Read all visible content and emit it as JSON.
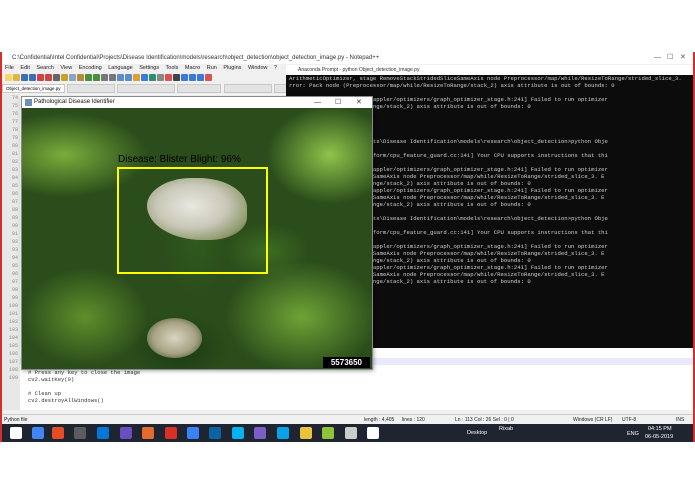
{
  "notepad": {
    "title": "C:\\Confidential\\Intel Confidential\\Projects\\Disease Identification\\models\\research\\object_detection\\object_detection_image.py - Notepad++",
    "menu": [
      "File",
      "Edit",
      "Search",
      "View",
      "Encoding",
      "Language",
      "Settings",
      "Tools",
      "Macro",
      "Run",
      "Plugins",
      "Window",
      "?"
    ],
    "tabs": [
      "Object_detection_image.py",
      "",
      "",
      "",
      "",
      ""
    ],
    "line_numbers": [
      "74",
      "75",
      "76",
      "77",
      "78",
      "79",
      "80",
      "81",
      "82",
      "83",
      "84",
      "85",
      "86",
      "87",
      "88",
      "89",
      "90",
      "91",
      "92",
      "93",
      "94",
      "95",
      "96",
      "97",
      "98",
      "99",
      "100",
      "101",
      "102",
      "103",
      "104",
      "105",
      "106",
      "107",
      "108",
      "109"
    ],
    "code": [
      "# Press any key to close the image",
      "cv2.waitKey(0)",
      "",
      "# Clean up",
      "cv2.destroyAllWindows()"
    ],
    "status": {
      "file_type": "Python file",
      "length": "length : 4,405",
      "lines": "lines : 120",
      "position": "Ln : 113   Col : 26   Sel : 0 | 0",
      "eol": "Windows (CR LF)",
      "encoding": "UTF-8",
      "mode": "INS"
    }
  },
  "console": {
    "title": "Anaconda Prompt - python  Object_detection_image.py",
    "lines": [
      "ArithmeticOptimizer, stage RemoveStackStridedSliceSameAxis node Preprocessor/map/while/ResizeToRange/strided_slice_3.",
      "rror: Pack node (Preprocessor/map/while/ResizeToRange/stack_2) axis attribute is out of bounds: 0",
      "",
      "7: W .\\tensorflow/core/grappler/optimizers/graph_optimizer_stage.h:241] Failed to run optimizer",
      "ssor/map/while/ResizeToRange/stack_2) axis attribute is out of bounds: 0",
      "",
      "",
      "",
      "",
      "Intel Confidential\\Projects\\Disease Identification\\models\\research\\object_detection>python Obje",
      "",
      "5: I tensorflow/core/platform/cpu_feature_guard.cc:141] Your CPU supports instructions that thi",
      "ot compiled to use: AVX2",
      "9: W .\\tensorflow/core/grappler/optimizers/graph_optimizer_stage.h:241] Failed to run optimizer",
      "e RemoveStackStridedSliceSameAxis node Preprocessor/map/while/ResizeToRange/strided_slice_3. E",
      "ssor/map/while/ResizeToRange/stack_2) axis attribute is out of bounds: 0",
      "0: W .\\tensorflow/core/grappler/optimizers/graph_optimizer_stage.h:241] Failed to run optimizer",
      "e RemoveStackStridedSliceSameAxis node Preprocessor/map/while/ResizeToRange/strided_slice_3. E",
      "ssor/map/while/ResizeToRange/stack_2) axis attribute is out of bounds: 0",
      "",
      "Intel Confidential\\Projects\\Disease Identification\\models\\research\\object_detection>python Obje",
      "",
      "5: I tensorflow/core/platform/cpu_feature_guard.cc:141] Your CPU supports instructions that thi",
      "ot compiled to use: AVX2",
      "7: W .\\tensorflow/core/grappler/optimizers/graph_optimizer_stage.h:241] Failed to run optimizer",
      "e RemoveStackStridedSliceSameAxis node Preprocessor/map/while/ResizeToRange/strided_slice_3. E",
      "ssor/map/while/ResizeToRange/stack_2) axis attribute is out of bounds: 0",
      "8: W .\\tensorflow/core/grappler/optimizers/graph_optimizer_stage.h:241] Failed to run optimizer",
      "e RemoveStackStridedSliceSameAxis node Preprocessor/map/while/ResizeToRange/strided_slice_3. E",
      "ssor/map/while/ResizeToRange/stack_2) axis attribute is out of bounds: 0"
    ]
  },
  "viewer": {
    "title": "Pathological Disease Identifier",
    "detection_label": "Disease: Blister Blight: 96%",
    "image_id": "5573650",
    "controls": [
      "—",
      "☐",
      "✕"
    ]
  },
  "taskbar": {
    "desktop_label": "Desktop",
    "user": "Rixab",
    "lang": "ENG",
    "time": "04:15 PM",
    "date": "06-05-2019",
    "icon_colors": [
      "#ffffff",
      "#4285f4",
      "#e44d26",
      "#5c5c5c",
      "#0078d7",
      "#6a4fbf",
      "#e46a2d",
      "#d93025",
      "#3b82f6",
      "#0a64a4",
      "#00b4f0",
      "#7b5fc7",
      "#0aa2e6",
      "#e8c33b",
      "#8fc33a",
      "#cccccc"
    ]
  },
  "colors": {
    "detection_box": "#ffff00",
    "frame_border": "#d32f2f"
  }
}
